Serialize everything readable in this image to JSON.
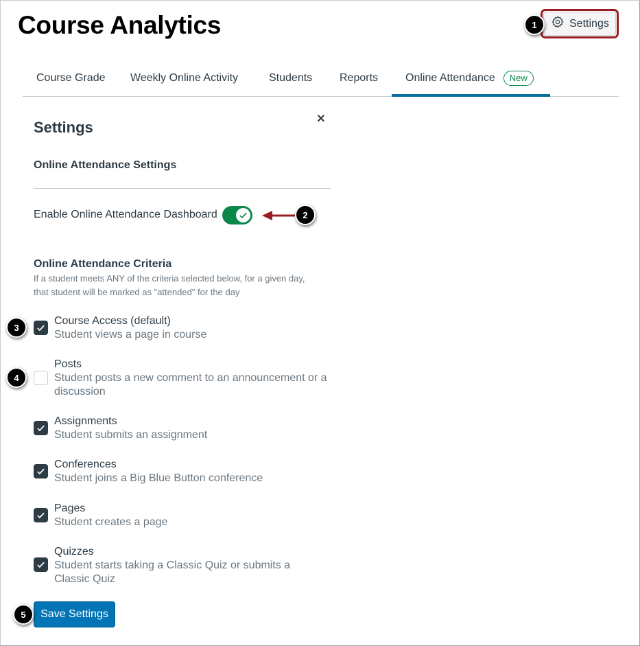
{
  "header": {
    "title": "Course Analytics",
    "settings_label": "Settings"
  },
  "tabs": [
    {
      "label": "Course Grade"
    },
    {
      "label": "Weekly Online Activity"
    },
    {
      "label": "Students"
    },
    {
      "label": "Reports"
    },
    {
      "label": "Online Attendance",
      "badge": "New",
      "active": true
    }
  ],
  "panel": {
    "title": "Settings",
    "close_symbol": "×",
    "section_title": "Online Attendance Settings",
    "toggle_label": "Enable Online Attendance Dashboard",
    "toggle_on": true,
    "criteria_title": "Online Attendance Criteria",
    "criteria_description": "If a student meets ANY of the criteria selected below, for a given day, that student will be marked as \"attended\" for the day",
    "criteria": [
      {
        "label": "Course Access (default)",
        "description": "Student views a page in course",
        "checked": true
      },
      {
        "label": "Posts",
        "description": "Student posts a new comment to an announcement or a discussion",
        "checked": false
      },
      {
        "label": "Assignments",
        "description": "Student submits an assignment",
        "checked": true
      },
      {
        "label": "Conferences",
        "description": "Student joins a Big Blue Button conference",
        "checked": true
      },
      {
        "label": "Pages",
        "description": "Student creates a page",
        "checked": true
      },
      {
        "label": "Quizzes",
        "description": "Student starts taking a Classic Quiz or submits a Classic Quiz",
        "checked": true
      }
    ],
    "save_label": "Save Settings"
  },
  "callouts": [
    "1",
    "2",
    "3",
    "4",
    "5"
  ],
  "colors": {
    "accent": "#0770a3",
    "button": "#0374b5",
    "toggle": "#0b874b",
    "highlight": "#9b1c20"
  },
  "icons": {
    "settings": "gear-icon",
    "close": "close-icon",
    "check": "check-icon",
    "arrow": "arrow-left-icon"
  }
}
